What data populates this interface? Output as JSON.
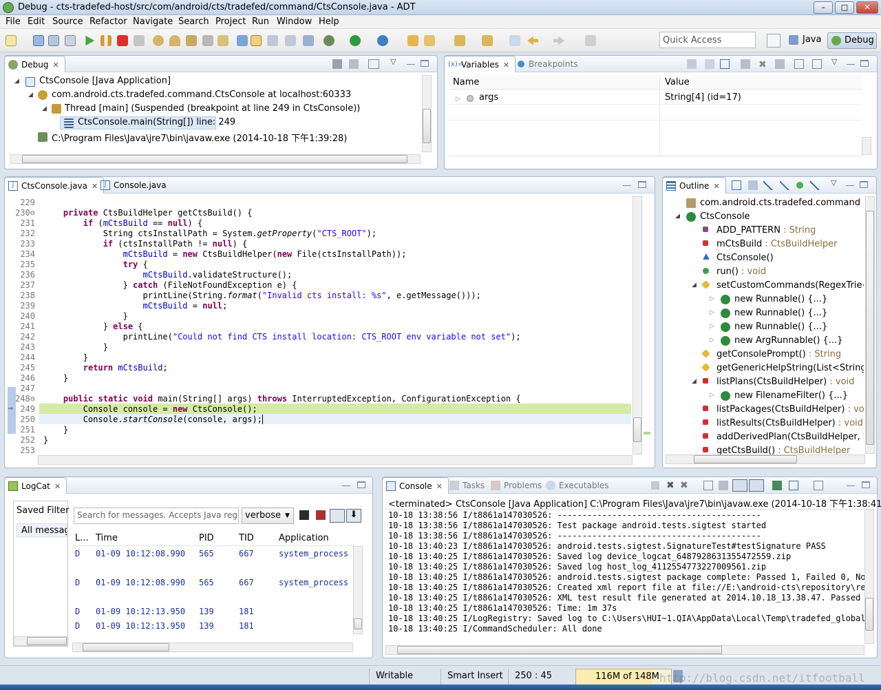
{
  "window": {
    "title": "Debug - cts-tradefed-host/src/com/android/cts/tradefed/command/CtsConsole.java - ADT",
    "min": "–",
    "max": "□",
    "close": "✕"
  },
  "menu": [
    "File",
    "Edit",
    "Source",
    "Refactor",
    "Navigate",
    "Search",
    "Project",
    "Run",
    "Window",
    "Help"
  ],
  "quick_access": {
    "placeholder": "Quick Access"
  },
  "perspectives": {
    "java": "Java",
    "debug": "Debug"
  },
  "debug_view": {
    "tab": "Debug",
    "items": [
      "CtsConsole [Java Application]",
      "com.android.cts.tradefed.command.CtsConsole at localhost:60333",
      "Thread [main] (Suspended (breakpoint at line 249 in CtsConsole))",
      "CtsConsole.main(String[]) line: 249",
      "C:\\Program Files\\Java\\jre7\\bin\\javaw.exe (2014-10-18 下午1:39:28)"
    ]
  },
  "variables_view": {
    "tabs": [
      "Variables",
      "Breakpoints"
    ],
    "columns": [
      "Name",
      "Value"
    ],
    "rows": [
      {
        "name": "args",
        "value": "String[4]  (id=17)"
      }
    ]
  },
  "editor": {
    "tabs": [
      "CtsConsole.java",
      "Console.java"
    ],
    "line_numbers": [
      "229",
      "230",
      "231",
      "232",
      "233",
      "234",
      "235",
      "236",
      "237",
      "238",
      "239",
      "240",
      "241",
      "242",
      "243",
      "244",
      "245",
      "246",
      "247",
      "248",
      "249",
      "250",
      "251",
      "252",
      "253"
    ]
  },
  "outline": {
    "tab": "Outline",
    "items": [
      {
        "name": "com.android.cts.tradefed.command",
        "type": ""
      },
      {
        "name": "CtsConsole",
        "type": ""
      },
      {
        "name": "ADD_PATTERN",
        "type": " : String"
      },
      {
        "name": "mCtsBuild",
        "type": " : CtsBuildHelper"
      },
      {
        "name": "CtsConsole()",
        "type": ""
      },
      {
        "name": "run()",
        "type": " : void"
      },
      {
        "name": "setCustomCommands(RegexTrie<F",
        "type": ""
      },
      {
        "name": "new Runnable() {...}",
        "type": ""
      },
      {
        "name": "new Runnable() {...}",
        "type": ""
      },
      {
        "name": "new Runnable() {...}",
        "type": ""
      },
      {
        "name": "new ArgRunnable() {...}",
        "type": ""
      },
      {
        "name": "getConsolePrompt()",
        "type": " : String"
      },
      {
        "name": "getGenericHelpString(List<String>)",
        "type": ""
      },
      {
        "name": "listPlans(CtsBuildHelper)",
        "type": " : void"
      },
      {
        "name": "new FilenameFilter() {...}",
        "type": ""
      },
      {
        "name": "listPackages(CtsBuildHelper)",
        "type": " : void"
      },
      {
        "name": "listResults(CtsBuildHelper)",
        "type": " : void"
      },
      {
        "name": "addDerivedPlan(CtsBuildHelper, St",
        "type": ""
      },
      {
        "name": "getCtsBuild()",
        "type": " : CtsBuildHelper"
      }
    ]
  },
  "logcat": {
    "tab": "LogCat",
    "saved_filters": "Saved Filter",
    "all_messages": "All messag",
    "search_placeholder": "Search for messages. Accepts Java rege",
    "level": "verbose",
    "columns": [
      "L...",
      "Time",
      "PID",
      "TID",
      "Application"
    ],
    "rows": [
      {
        "level": "D",
        "time": "01-09 10:12:08.990",
        "pid": "565",
        "tid": "667",
        "app": "system_process"
      },
      {
        "level": "D",
        "time": "01-09 10:12:08.990",
        "pid": "565",
        "tid": "667",
        "app": "system_process"
      },
      {
        "level": "D",
        "time": "01-09 10:12:13.950",
        "pid": "139",
        "tid": "181",
        "app": ""
      },
      {
        "level": "D",
        "time": "01-09 10:12:13.950",
        "pid": "139",
        "tid": "181",
        "app": ""
      }
    ]
  },
  "console": {
    "tabs": [
      "Console",
      "Tasks",
      "Problems",
      "Executables"
    ],
    "header": "<terminated> CtsConsole [Java Application] C:\\Program Files\\Java\\jre7\\bin\\javaw.exe (2014-10-18 下午1:38:41)",
    "lines": [
      "10-18 13:38:56 I/t8861a147030526: -----------------------------------------",
      "10-18 13:38:56 I/t8861a147030526: Test package android.tests.sigtest started",
      "10-18 13:38:56 I/t8861a147030526: -----------------------------------------",
      "10-18 13:40:23 I/t8861a147030526: android.tests.sigtest.SignatureTest#testSignature PASS",
      "10-18 13:40:25 I/t8861a147030526: Saved log device_logcat_6487928631355472559.zip",
      "10-18 13:40:25 I/t8861a147030526: Saved log host_log_4112554773227009561.zip",
      "10-18 13:40:25 I/t8861a147030526: android.tests.sigtest package complete: Passed 1, Failed 0, Not",
      "10-18 13:40:25 I/t8861a147030526: Created xml report file at file://E:\\android-cts\\repository\\resu",
      "10-18 13:40:25 I/t8861a147030526: XML test result file generated at 2014.10.18_13.38.47. Passed 1,",
      "10-18 13:40:25 I/t8861a147030526: Time: 1m 37s",
      "10-18 13:40:25 I/LogRegistry: Saved log to C:\\Users\\HUI~1.QIA\\AppData\\Local\\Temp\\tradefed_global_l",
      "10-18 13:40:25 I/CommandScheduler: All done"
    ]
  },
  "status": {
    "writable": "Writable",
    "insert": "Smart Insert",
    "position": "250 : 45",
    "heap": "116M of 148M",
    "watermark": "http://blog.csdn.net/itfootball"
  },
  "colors": {
    "highlight": "#d4eaa7",
    "selection": "#dce8f8",
    "keyword": "#7f0055",
    "field": "#0000c0",
    "string": "#2a00ff"
  }
}
